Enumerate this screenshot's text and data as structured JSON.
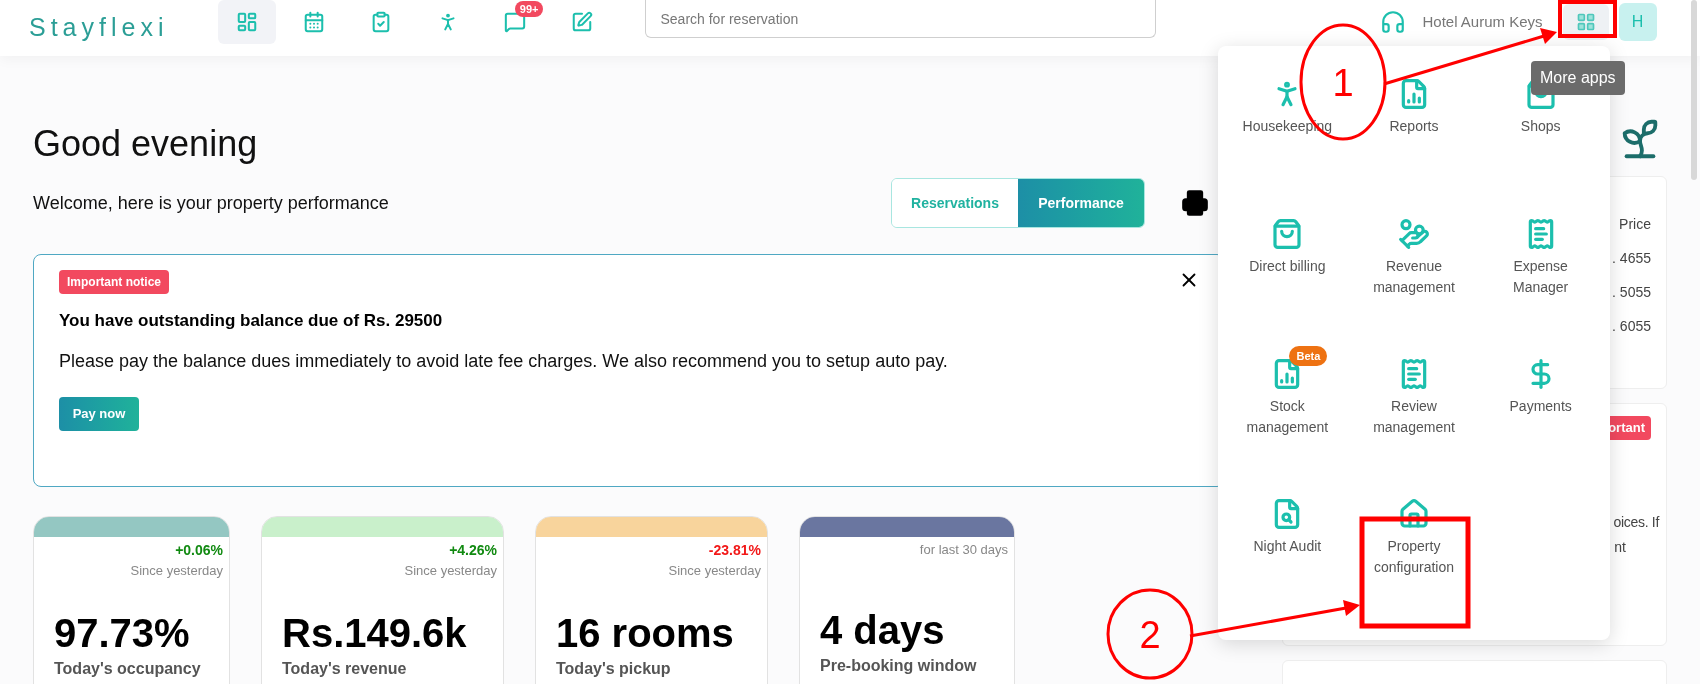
{
  "logo": "Stayflexi",
  "nav": [
    {
      "kind": "dashboard",
      "selected": true
    },
    {
      "kind": "calendar",
      "selected": false
    },
    {
      "kind": "tasks",
      "selected": false
    },
    {
      "kind": "housekeeping",
      "selected": false
    },
    {
      "kind": "messages",
      "selected": false,
      "badge": "99+"
    },
    {
      "kind": "notes",
      "selected": false
    }
  ],
  "search": {
    "placeholder": "Search for reservation"
  },
  "hotel_name": "Hotel Aurum Keys",
  "avatar": "H",
  "tooltip": "More apps",
  "apps_menu": [
    {
      "kind": "housekeeping",
      "label": "Housekeeping"
    },
    {
      "kind": "reports",
      "label": "Reports"
    },
    {
      "kind": "shops",
      "label": "Shops"
    },
    {
      "kind": "billing",
      "label": "Direct billing"
    },
    {
      "kind": "revenue",
      "label": "Revenue management"
    },
    {
      "kind": "expense",
      "label": "Expense Manager"
    },
    {
      "kind": "stock",
      "label": "Stock management",
      "badge": "Beta"
    },
    {
      "kind": "review",
      "label": "Review management"
    },
    {
      "kind": "payments",
      "label": "Payments"
    },
    {
      "kind": "audit",
      "label": "Night Audit"
    },
    {
      "kind": "property",
      "label": "Property configuration"
    }
  ],
  "greeting": "Good evening",
  "subtitle": "Welcome, here is your property performance",
  "view_toggle": [
    {
      "label": "Reservations",
      "selected": false
    },
    {
      "label": "Performance",
      "selected": true
    }
  ],
  "notice": {
    "badge": "Important notice",
    "title": "You have outstanding balance due of Rs. 29500",
    "message": "Please pay the balance dues immediately to avoid late fee charges. We also recommend you to setup auto pay.",
    "button": "Pay now"
  },
  "stats": [
    {
      "color": "#94c7c2",
      "change": {
        "text": "+0.06%",
        "color": "#118a11"
      },
      "caption": "Since yesterday",
      "value": "97.73%",
      "label": "Today's occupancy"
    },
    {
      "color": "#c9f0cb",
      "change": {
        "text": "+4.26%",
        "color": "#118a11"
      },
      "caption": "Since yesterday",
      "value": "Rs.149.6k",
      "label": "Today's revenue"
    },
    {
      "color": "#f8d49c",
      "change": {
        "text": "-23.81%",
        "color": "#f21818"
      },
      "caption": "Since yesterday",
      "value": "16 rooms",
      "label": "Today's pickup"
    },
    {
      "color": "#6a76a0",
      "caption": "for last 30 days",
      "value": "4 days",
      "label": "Pre-booking window"
    }
  ],
  "side_cards": [
    {
      "lines": [
        "Price",
        ". 4655",
        ". 5055",
        ". 6055"
      ]
    },
    {
      "badge": "ortant",
      "lines": [
        "oices. If",
        "nt"
      ]
    }
  ],
  "annotations": [
    {
      "label": "1"
    },
    {
      "label": "2"
    }
  ]
}
